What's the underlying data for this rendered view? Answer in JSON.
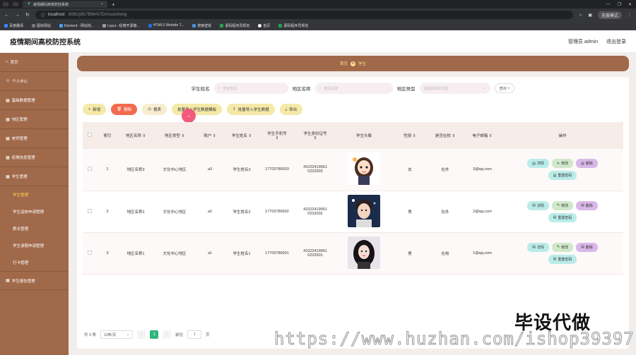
{
  "browser": {
    "tab_title": "疫情期间高校防控系统",
    "url_host": "localhost",
    "url_rest": ":8081/ji5k7B8e%7D#/xuesheng",
    "profile": "无痕模式",
    "bookmarks": [
      "百度翻译",
      "图标网站",
      "Element - 网站快...",
      "Layui - 经典开源模...",
      "HTML5 Website T...",
      "搜索壁纸",
      "源码程序员规划",
      "首页",
      "源码程序员规划"
    ]
  },
  "header": {
    "title": "疫情期间高校防控系统",
    "admin": "管理员 admin",
    "logout": "退出登录"
  },
  "sidebar": {
    "items": [
      {
        "label": "首页",
        "icon": "home-icon"
      },
      {
        "label": "个人中心",
        "icon": "user-icon"
      },
      {
        "label": "基础数据管理",
        "icon": "grid-icon"
      },
      {
        "label": "地区管理",
        "icon": "grid-icon"
      },
      {
        "label": "老师管理",
        "icon": "grid-icon"
      },
      {
        "label": "疫情信息管理",
        "icon": "grid-icon"
      },
      {
        "label": "学生管理",
        "icon": "grid-icon"
      }
    ],
    "subitems": [
      "学生管理",
      "学生返校申请管理",
      "薪水管理",
      "学生请假申请管理",
      "打卡管理"
    ],
    "last_item": {
      "label": "学生报告管理",
      "icon": "grid-icon"
    }
  },
  "breadcrumb": {
    "home": "首页",
    "current": "学生"
  },
  "search": {
    "name_label": "学生姓名",
    "name_placeholder": "学生姓名",
    "area_label": "地区名称",
    "area_placeholder": "地区名称",
    "type_label": "地区类型",
    "type_placeholder": "请选择地区类型",
    "button": "查询"
  },
  "toolbar": {
    "add": "新增",
    "delete": "删除",
    "report": "报表",
    "import_template": "批量导入学生数据模板",
    "import": "批量导入学生数据",
    "export": "导出"
  },
  "table": {
    "headers": [
      "索引",
      "地区名称",
      "地区类型",
      "账户",
      "学生姓名",
      "学生手机号",
      "学生身份证号",
      "学生头像",
      "性别",
      "是否在校",
      "电子邮箱",
      "操作"
    ],
    "rows": [
      {
        "index": "1",
        "area": "地区名称3",
        "type": "文化中心地区",
        "account": "a3",
        "name": "学生姓名3",
        "phone": "17703786903",
        "id1": "41022419961",
        "id2": "0232003",
        "gender": "女",
        "status": "在外",
        "email": "3@qq.com",
        "avatar": "avatar-cartoon-girl"
      },
      {
        "index": "2",
        "area": "地区名称2",
        "type": "文化中心地区",
        "account": "a2",
        "name": "学生姓名2",
        "phone": "17703786902",
        "id1": "41022419961",
        "id2": "0232002",
        "gender": "男",
        "status": "在外",
        "email": "2@qq.com",
        "avatar": "avatar-boy"
      },
      {
        "index": "3",
        "area": "地区名称1",
        "type": "文化中心地区",
        "account": "a1",
        "name": "学生姓名1",
        "phone": "17703786901",
        "id1": "41022419961",
        "id2": "0232001",
        "gender": "男",
        "status": "在校",
        "email": "1@qq.com",
        "avatar": "avatar-girl"
      }
    ],
    "ops": {
      "detail": "详情",
      "edit": "修改",
      "delete": "删除",
      "reset": "重置密码"
    }
  },
  "pager": {
    "total": "共 3 条",
    "size": "10条/页",
    "page": "1",
    "goto": "前往",
    "goto_value": "1",
    "page_unit": "页"
  },
  "watermark": {
    "big": "毕设代做",
    "url": "https://www.huzhan.com/ishop39397"
  },
  "colors": {
    "sidebar": "#a0694a",
    "accent": "#ffd84a",
    "danger": "#f26a4f"
  }
}
